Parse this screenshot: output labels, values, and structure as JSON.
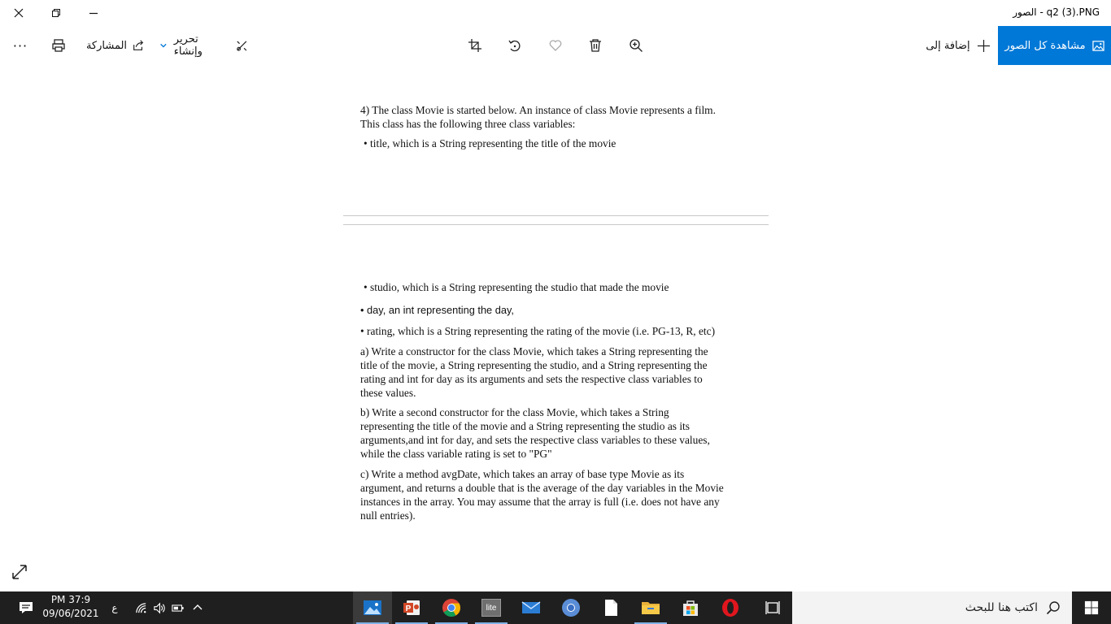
{
  "window": {
    "title": "الصور - q2 (3).PNG"
  },
  "toolbar": {
    "view_all_label": "مشاهدة كل الصور",
    "add_to_label": "إضافة إلى",
    "edit_create_label": "تحرير وإنشاء",
    "share_label": "المشاركة",
    "more_label": "···"
  },
  "document": {
    "intro_line1": "4) The class Movie is started below. An instance of class Movie represents a film.",
    "intro_line2": "This class has the following three class variables:",
    "bullet_title": "• title, which is a String representing the title of the movie",
    "bullet_studio": "• studio, which is a String representing the studio that made the movie",
    "bullet_day": "• day, an int representing the day,",
    "bullet_rating": "• rating, which is a String representing the rating of the movie (i.e. PG-13, R, etc)",
    "part_a": [
      "a) Write a constructor for the class Movie, which takes a String representing the",
      "title of the movie, a String representing the studio, and a String representing the",
      "rating and int for day as its arguments and sets the respective class variables to",
      "these values."
    ],
    "part_b": [
      "b) Write a second constructor for the class Movie, which takes a String",
      "representing the title of the movie and a String representing the studio as its",
      "arguments,and int for day, and sets the respective class variables to these values,",
      "while the class variable rating is set to \"PG\""
    ],
    "part_c": [
      "c) Write a method avgDate, which takes an array of base type Movie as its",
      "argument, and returns a double that is the average of the day variables in the Movie",
      "instances in the array. You may assume that the array is full (i.e. does not have any",
      "null entries)."
    ]
  },
  "taskbar": {
    "search_placeholder": "اكتب هنا للبحث",
    "time": "PM 37:9",
    "date": "09/06/2021",
    "lang": "ع",
    "lite_label": "lite"
  },
  "colors": {
    "accent": "#0078d7",
    "taskbar": "#1f1f1f",
    "spellcheck": "#cc2b2b"
  }
}
